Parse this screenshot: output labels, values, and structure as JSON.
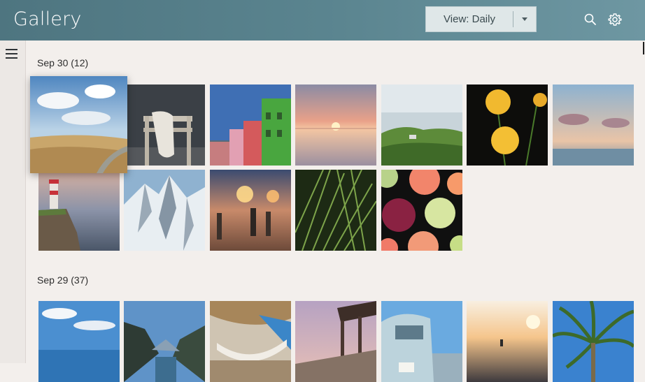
{
  "header": {
    "title": "Gallery",
    "view_dropdown_label": "View: Daily",
    "search_icon": "search-icon",
    "settings_icon": "gear-icon"
  },
  "sidebar": {
    "menu_icon": "hamburger-menu-icon"
  },
  "sections": [
    {
      "title": "Sep 30 (12)"
    },
    {
      "title": "Sep 29 (37)"
    }
  ],
  "colors": {
    "header_bg": "#5a848f",
    "page_bg": "#f3efec",
    "header_text": "#ffffff"
  }
}
